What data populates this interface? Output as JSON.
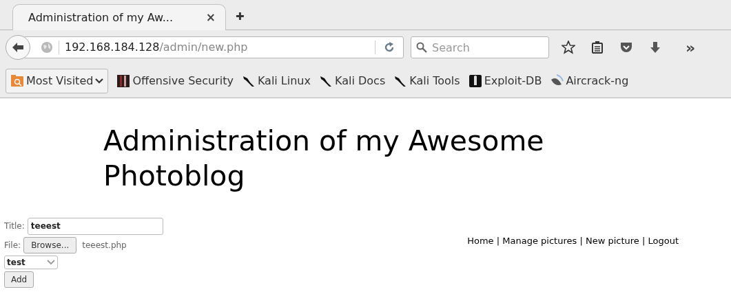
{
  "browser": {
    "tab": {
      "title": "Administration of my Aw...",
      "close": "×",
      "selected": true
    },
    "new_tab": "✚",
    "url": {
      "host": "192.168.184.128",
      "path": "/admin/new.php"
    },
    "search": {
      "placeholder": "Search"
    },
    "overflow": "»",
    "bookmarks": [
      {
        "label": "Most Visited",
        "kind": "folder"
      },
      {
        "label": "Offensive Security",
        "kind": "offsec"
      },
      {
        "label": "Kali Linux",
        "kind": "kali"
      },
      {
        "label": "Kali Docs",
        "kind": "kali"
      },
      {
        "label": "Kali Tools",
        "kind": "kali"
      },
      {
        "label": "Exploit-DB",
        "kind": "exploit"
      },
      {
        "label": "Aircrack-ng",
        "kind": "dish"
      }
    ]
  },
  "page": {
    "heading": "Administration of my Awesome Photoblog",
    "form": {
      "title_label": "Title:",
      "title_value": "teeest",
      "file_label": "File:",
      "browse": "Browse...",
      "file_name": "teeest.php",
      "category": "test",
      "submit": "Add"
    },
    "nav": [
      {
        "label": "Home",
        "separator": "|"
      },
      {
        "label": "Manage pictures",
        "separator": "|"
      },
      {
        "label": "New picture",
        "separator": "|"
      },
      {
        "label": "Logout"
      }
    ]
  }
}
